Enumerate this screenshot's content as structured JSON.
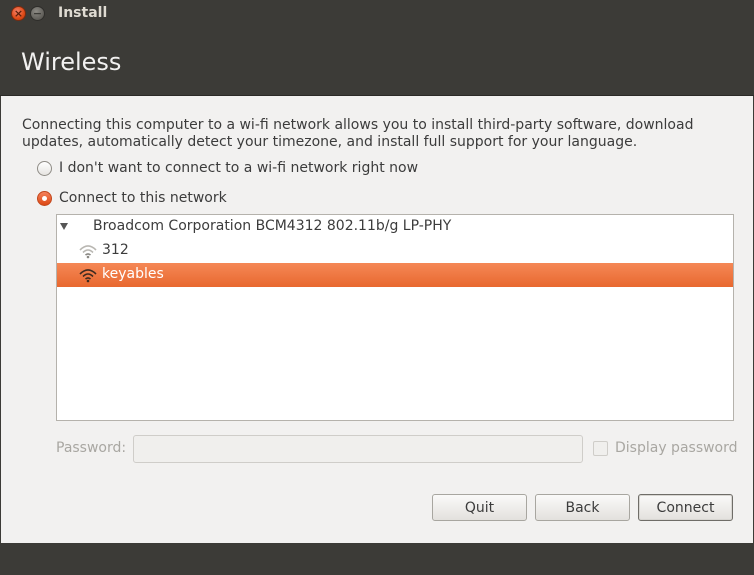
{
  "window": {
    "title": "Install",
    "close_glyph": "×",
    "minimize_glyph": "−"
  },
  "header": {
    "title": "Wireless"
  },
  "main": {
    "description": "Connecting this computer to a wi-fi network allows you to install third-party software, download updates, automatically detect your timezone, and install full support for your language.",
    "options": [
      {
        "label": "I don't want to connect to a wi-fi network right now",
        "checked": false
      },
      {
        "label": "Connect to this network",
        "checked": true
      }
    ],
    "network_list": {
      "device": "Broadcom Corporation BCM4312 802.11b/g LP-PHY",
      "expanded": true,
      "networks": [
        {
          "name": "312",
          "selected": false,
          "icon": "wifi-signal-icon"
        },
        {
          "name": "keyables",
          "selected": true,
          "icon": "wifi-signal-icon"
        }
      ]
    },
    "password": {
      "label": "Password:",
      "value": "",
      "enabled": false
    },
    "display_password": {
      "label": "Display password",
      "checked": false,
      "enabled": false
    }
  },
  "buttons": {
    "quit": "Quit",
    "back": "Back",
    "connect": "Connect"
  },
  "colors": {
    "accent": "#dd4814",
    "selection": "#f07746",
    "chrome": "#3c3b37",
    "background": "#f2f1f0"
  }
}
